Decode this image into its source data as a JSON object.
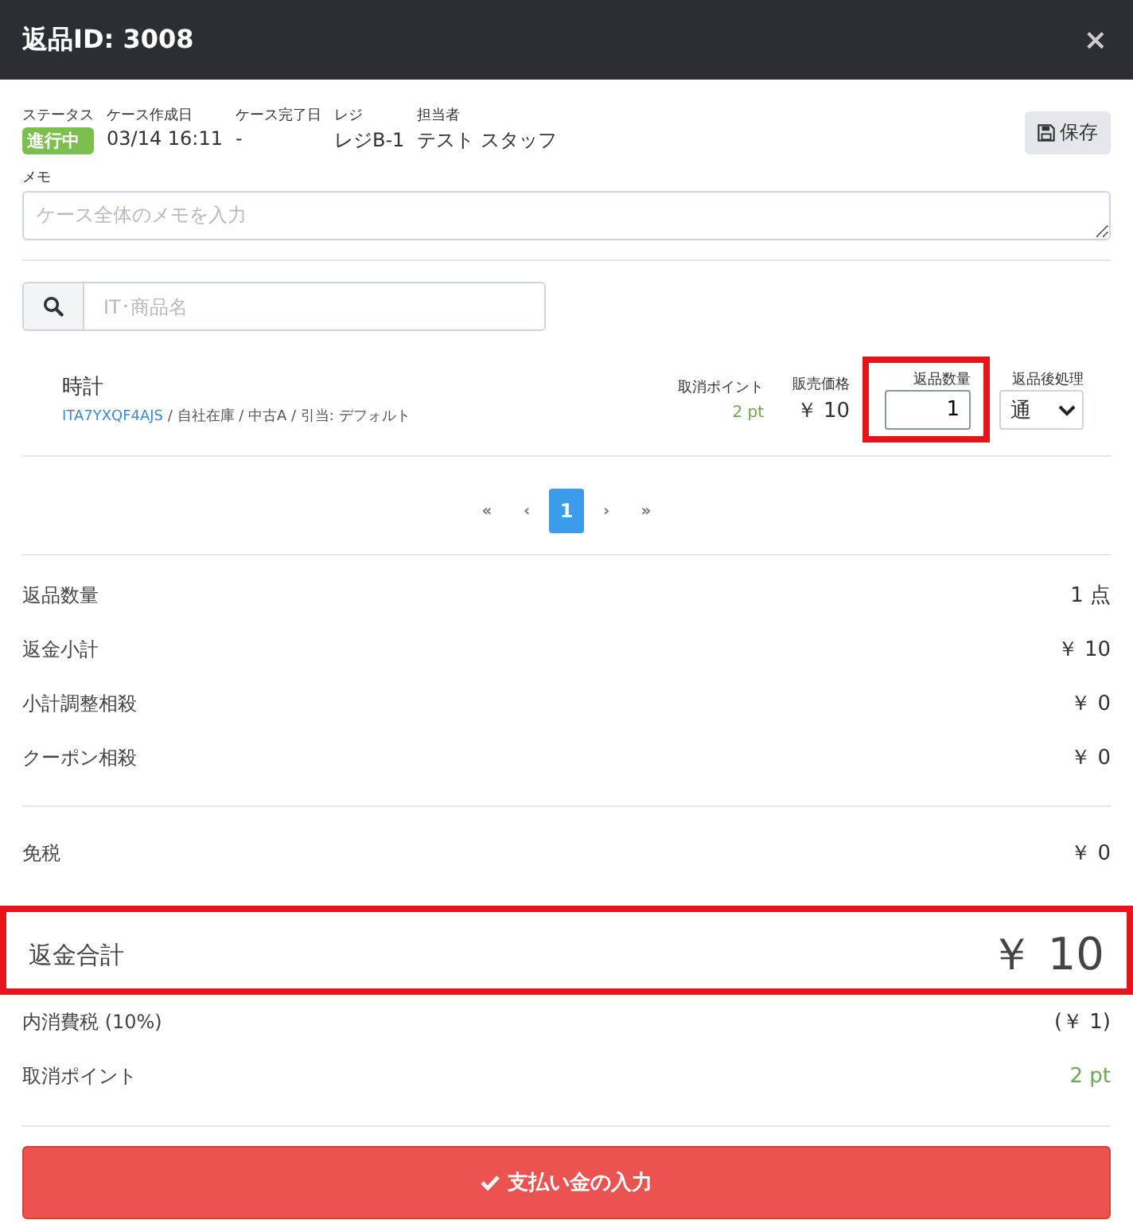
{
  "window": {
    "title": "返品ID: 3008",
    "close": "×"
  },
  "info": {
    "fields": [
      {
        "label": "ステータス",
        "value": "進行中",
        "kind": "badge"
      },
      {
        "label": "ケース作成日",
        "value": "03/14 16:11",
        "kind": "text"
      },
      {
        "label": "ケース完了日",
        "value": "-",
        "kind": "text"
      },
      {
        "label": "レジ",
        "value": "レジB-1",
        "kind": "text"
      },
      {
        "label": "担当者",
        "value": "テスト スタッフ",
        "kind": "text"
      }
    ],
    "save_button": "保存"
  },
  "memo": {
    "label": "メモ",
    "placeholder": "ケース全体のメモを入力"
  },
  "search": {
    "placeholder": "IT･商品名"
  },
  "items": [
    {
      "name": "時計",
      "code": "ITA7YXQF4AJS",
      "detail": " / 自社在庫 / 中古A / 引当: デフォルト",
      "points_label": "取消ポイント",
      "points": "2 pt",
      "price_label": "販売価格",
      "price": "￥ 10",
      "qty_label": "返品数量",
      "qty": "1",
      "qty_highlighted": true,
      "after_label": "返品後処理",
      "after": "通"
    }
  ],
  "pagination": [
    {
      "label": "«",
      "selected": false
    },
    {
      "label": "‹",
      "selected": false
    },
    {
      "label": "1",
      "selected": true
    },
    {
      "label": "›",
      "selected": false
    },
    {
      "label": "»",
      "selected": false
    }
  ],
  "summary": [
    {
      "label": "返品数量",
      "value": "1 点"
    },
    {
      "label": "返金小計",
      "value": "￥ 10"
    },
    {
      "label": "小計調整相殺",
      "value": "￥ 0"
    },
    {
      "label": "クーポン相殺",
      "value": "￥ 0"
    }
  ],
  "tax_free": {
    "label": "免税",
    "value": "￥ 0"
  },
  "total": {
    "label": "返金合計",
    "value": "￥ 10",
    "highlighted": true
  },
  "tax": {
    "label": "内消費税 (10%)",
    "value": "(￥ 1)"
  },
  "cancel_points": {
    "label": "取消ポイント",
    "value": "2 pt"
  },
  "pay_button": "支払い金の入力"
}
